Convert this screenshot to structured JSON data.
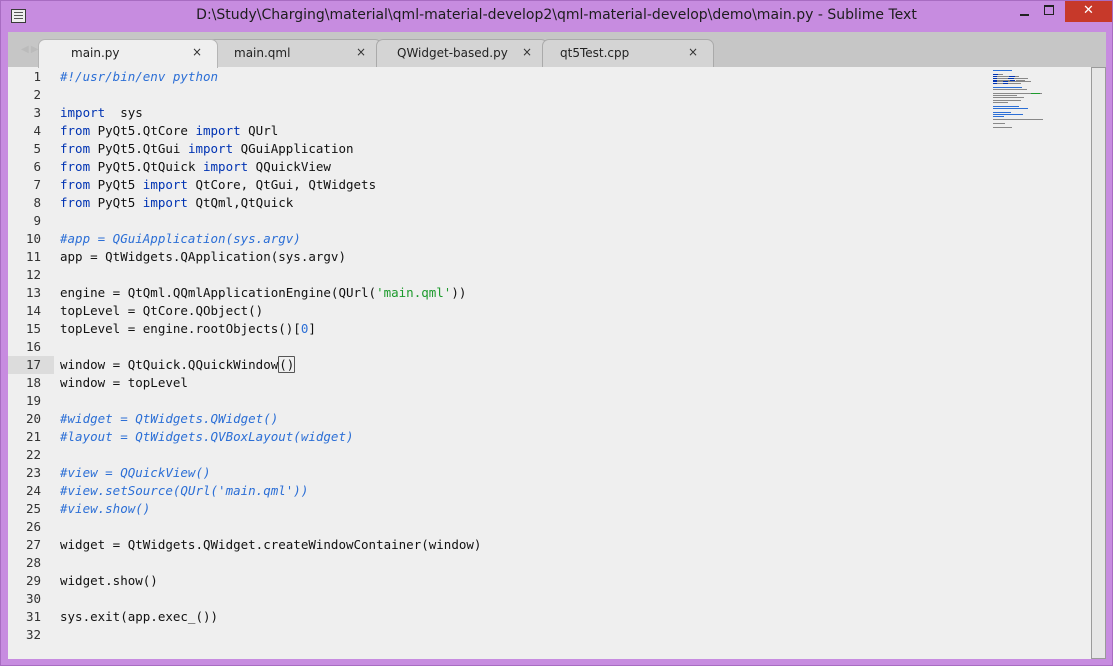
{
  "window": {
    "title": "D:\\Study\\Charging\\material\\qml-material-develop2\\qml-material-develop\\demo\\main.py - Sublime Text",
    "minimize_icon": "minimize-icon",
    "maximize_icon": "maximize-icon",
    "close_label": "✕"
  },
  "tabs": [
    {
      "label": "main.py",
      "active": true,
      "close": "×"
    },
    {
      "label": "main.qml",
      "active": false,
      "close": "×"
    },
    {
      "label": "QWidget-based.py",
      "active": false,
      "close": "×"
    },
    {
      "label": "qt5Test.cpp",
      "active": false,
      "close": "×"
    }
  ],
  "editor": {
    "current_line": 17,
    "line_numbers": [
      "1",
      "2",
      "3",
      "4",
      "5",
      "6",
      "7",
      "8",
      "9",
      "10",
      "11",
      "12",
      "13",
      "14",
      "15",
      "16",
      "17",
      "18",
      "19",
      "20",
      "21",
      "22",
      "23",
      "24",
      "25",
      "26",
      "27",
      "28",
      "29",
      "30",
      "31",
      "32"
    ],
    "lines": [
      [
        [
          "cm",
          "#!/usr/bin/env python"
        ]
      ],
      [],
      [
        [
          "kw",
          "import"
        ],
        [
          "",
          "  sys"
        ]
      ],
      [
        [
          "kw",
          "from"
        ],
        [
          "",
          " PyQt5.QtCore "
        ],
        [
          "kw",
          "import"
        ],
        [
          "",
          " QUrl"
        ]
      ],
      [
        [
          "kw",
          "from"
        ],
        [
          "",
          " PyQt5.QtGui "
        ],
        [
          "kw",
          "import"
        ],
        [
          "",
          " QGuiApplication"
        ]
      ],
      [
        [
          "kw",
          "from"
        ],
        [
          "",
          " PyQt5.QtQuick "
        ],
        [
          "kw",
          "import"
        ],
        [
          "",
          " QQuickView"
        ]
      ],
      [
        [
          "kw",
          "from"
        ],
        [
          "",
          " PyQt5 "
        ],
        [
          "kw",
          "import"
        ],
        [
          "",
          " QtCore, QtGui, QtWidgets"
        ]
      ],
      [
        [
          "kw",
          "from"
        ],
        [
          "",
          " PyQt5 "
        ],
        [
          "kw",
          "import"
        ],
        [
          "",
          " QtQml,QtQuick"
        ]
      ],
      [],
      [
        [
          "cm",
          "#app = QGuiApplication(sys.argv)"
        ]
      ],
      [
        [
          "",
          "app = QtWidgets.QApplication(sys.argv)"
        ]
      ],
      [],
      [
        [
          "",
          "engine = QtQml.QQmlApplicationEngine(QUrl("
        ],
        [
          "st",
          "'main.qml'"
        ],
        [
          "",
          "))"
        ]
      ],
      [
        [
          "",
          "topLevel = QtCore.QObject()"
        ]
      ],
      [
        [
          "",
          "topLevel = engine.rootObjects()["
        ],
        [
          "nu",
          "0"
        ],
        [
          "",
          "]"
        ]
      ],
      [],
      [
        [
          "",
          "window = QtQuick.QQuickWindow"
        ],
        [
          "cur",
          "()"
        ]
      ],
      [
        [
          "",
          "window = topLevel"
        ]
      ],
      [],
      [
        [
          "cm",
          "#widget = QtWidgets.QWidget()"
        ]
      ],
      [
        [
          "cm",
          "#layout = QtWidgets.QVBoxLayout(widget)"
        ]
      ],
      [],
      [
        [
          "cm",
          "#view = QQuickView()"
        ]
      ],
      [
        [
          "cm",
          "#view.setSource(QUrl('main.qml'))"
        ]
      ],
      [
        [
          "cm",
          "#view.show()"
        ]
      ],
      [],
      [
        [
          "",
          "widget = QtWidgets.QWidget.createWindowContainer(window)"
        ]
      ],
      [],
      [
        [
          "",
          "widget.show()"
        ]
      ],
      [],
      [
        [
          "",
          "sys.exit(app.exec_())"
        ]
      ],
      []
    ]
  },
  "colors": {
    "window_border": "#c78ce0",
    "editor_bg": "#efefef",
    "keyword": "#0033b3",
    "comment": "#2c6fd6",
    "string": "#1c9a2c",
    "close_button": "#c7392a"
  }
}
